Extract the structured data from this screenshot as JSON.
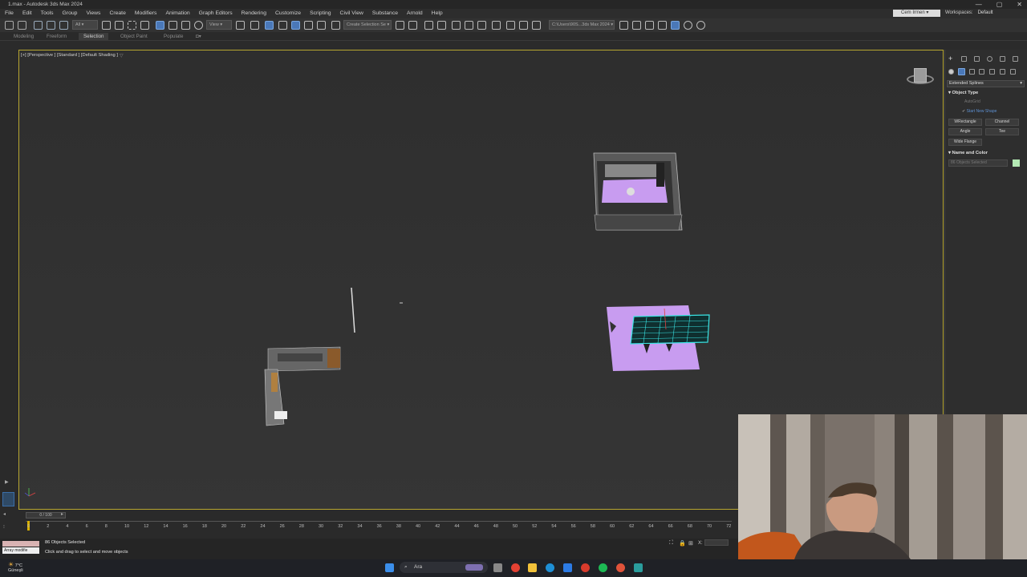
{
  "window": {
    "title": "1.max - Autodesk 3ds Max 2024",
    "controls": [
      "—",
      "▢",
      "✕"
    ]
  },
  "menu": {
    "items": [
      "File",
      "Edit",
      "Tools",
      "Group",
      "Views",
      "Create",
      "Modifiers",
      "Animation",
      "Graph Editors",
      "Rendering",
      "Customize",
      "Scripting",
      "Civil View",
      "Substance",
      "Arnold",
      "Help"
    ],
    "user": "Cem Irmen",
    "workspaces_label": "Workspaces:",
    "workspace_value": "Default"
  },
  "toolbar": {
    "filter_value": "All",
    "ref_coord_value": "View",
    "selection_set_placeholder": "Create Selection Se",
    "path_value": "C:\\Users\\90S...3ds Max 2024"
  },
  "ribbon": {
    "tabs": [
      "Modeling",
      "Freeform",
      "Selection",
      "Object Paint",
      "Populate"
    ],
    "active_tab": "Selection"
  },
  "viewport": {
    "label": "[+] [Perspective ] [Standard ] [Default Shading ]"
  },
  "command_panel": {
    "category_dropdown": "Extended Splines",
    "object_type_header": "Object Type",
    "autogrid_label": "AutoGrid",
    "start_new_shape_label": "Start New Shape",
    "buttons": [
      "WRectangle",
      "Channel",
      "Angle",
      "Tee",
      "Wide Flange"
    ],
    "name_color_header": "Name and Color",
    "name_field_value": "86 Objects Selected",
    "color_swatch": "#b3e8b3"
  },
  "timeline": {
    "frame_counter": "0 / 100",
    "ticks": [
      "0",
      "2",
      "4",
      "6",
      "8",
      "10",
      "12",
      "14",
      "16",
      "18",
      "20",
      "22",
      "24",
      "26",
      "28",
      "30",
      "32",
      "34",
      "36",
      "38",
      "40",
      "42",
      "44",
      "46",
      "48",
      "50",
      "52",
      "54",
      "56",
      "58",
      "60",
      "62",
      "64",
      "66",
      "68",
      "70",
      "72"
    ]
  },
  "status": {
    "maxscript_input": "Array modifie",
    "selection_count": "86 Objects Selected",
    "prompt": "Click and drag to select and move objects",
    "coords_label": "X:"
  },
  "taskbar": {
    "weather_temp": "7°C",
    "weather_desc": "Güneşli",
    "search_placeholder": "Ara"
  },
  "colors": {
    "viewport_border": "#b7a630",
    "accent_purple": "#c89cf0",
    "selection_cyan": "#39e3e3"
  }
}
